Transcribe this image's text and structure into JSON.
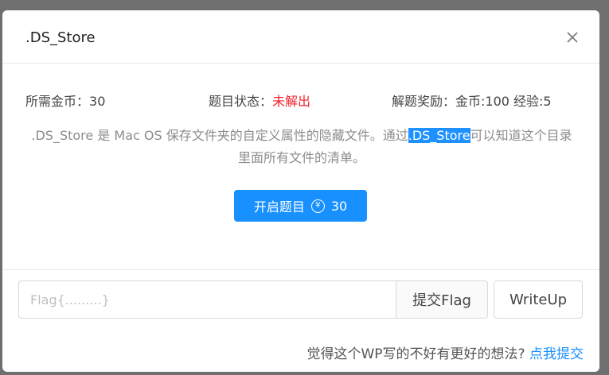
{
  "modal": {
    "title": ".DS_Store",
    "close_icon": "close-icon"
  },
  "info": {
    "cost_label": "所需金币：",
    "cost_value": "30",
    "status_label": "题目状态：",
    "status_value": "未解出",
    "reward_label": "解题奖励：",
    "reward_value": "金币:100 经验:5"
  },
  "description": {
    "before": ".DS_Store 是 Mac OS 保存文件夹的自定义属性的隐藏文件。通过",
    "highlight": ".DS_Store",
    "after": "可以知道这个目录里面所有文件的清单。"
  },
  "start_button": {
    "label": "开启题目",
    "icon": "yen-circle-icon",
    "icon_glyph": "¥",
    "cost": "30"
  },
  "flag_form": {
    "placeholder": "Flag{.........}",
    "value": "",
    "submit_label": "提交Flag",
    "writeup_label": "WriteUp"
  },
  "footer": {
    "question": "觉得这个WP写的不好有更好的想法?",
    "link_label": "点我提交"
  },
  "colors": {
    "primary": "#1890ff",
    "status_red": "#f5222d",
    "overlay": "#6f6f6f"
  }
}
